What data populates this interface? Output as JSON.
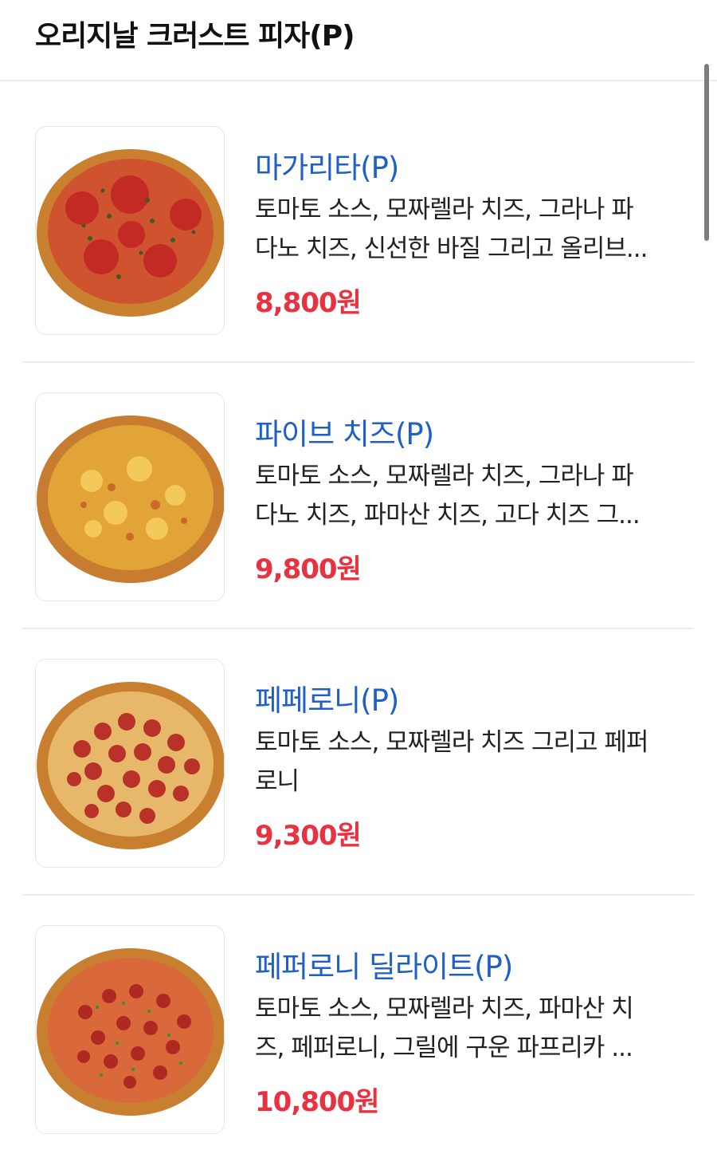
{
  "header": {
    "title": "오리지날 크러스트 피자(P)"
  },
  "items": [
    {
      "name": "마가리타(P)",
      "desc_line1": "토마토 소스, 모짜렐라 치즈, 그라나 파",
      "desc_line2": "다노 치즈, 신선한 바질 그리고 올리브...",
      "price": "8,800원",
      "image": "margherita-pizza-photo"
    },
    {
      "name": "파이브 치즈(P)",
      "desc_line1": "토마토 소스, 모짜렐라 치즈, 그라나 파",
      "desc_line2": "다노 치즈, 파마산 치즈, 고다 치즈 그...",
      "price": "9,800원",
      "image": "five-cheese-pizza-photo"
    },
    {
      "name": "페페로니(P)",
      "desc_line1": "토마토 소스, 모짜렐라 치즈 그리고 페퍼",
      "desc_line2": "로니",
      "price": "9,300원",
      "image": "pepperoni-pizza-photo"
    },
    {
      "name": "페퍼로니 딜라이트(P)",
      "desc_line1": "토마토 소스, 모짜렐라 치즈, 파마산 치",
      "desc_line2": "즈, 페퍼로니, 그릴에 구운 파프리카 ...",
      "price": "10,800원",
      "image": "pepperoni-delight-pizza-photo"
    }
  ]
}
